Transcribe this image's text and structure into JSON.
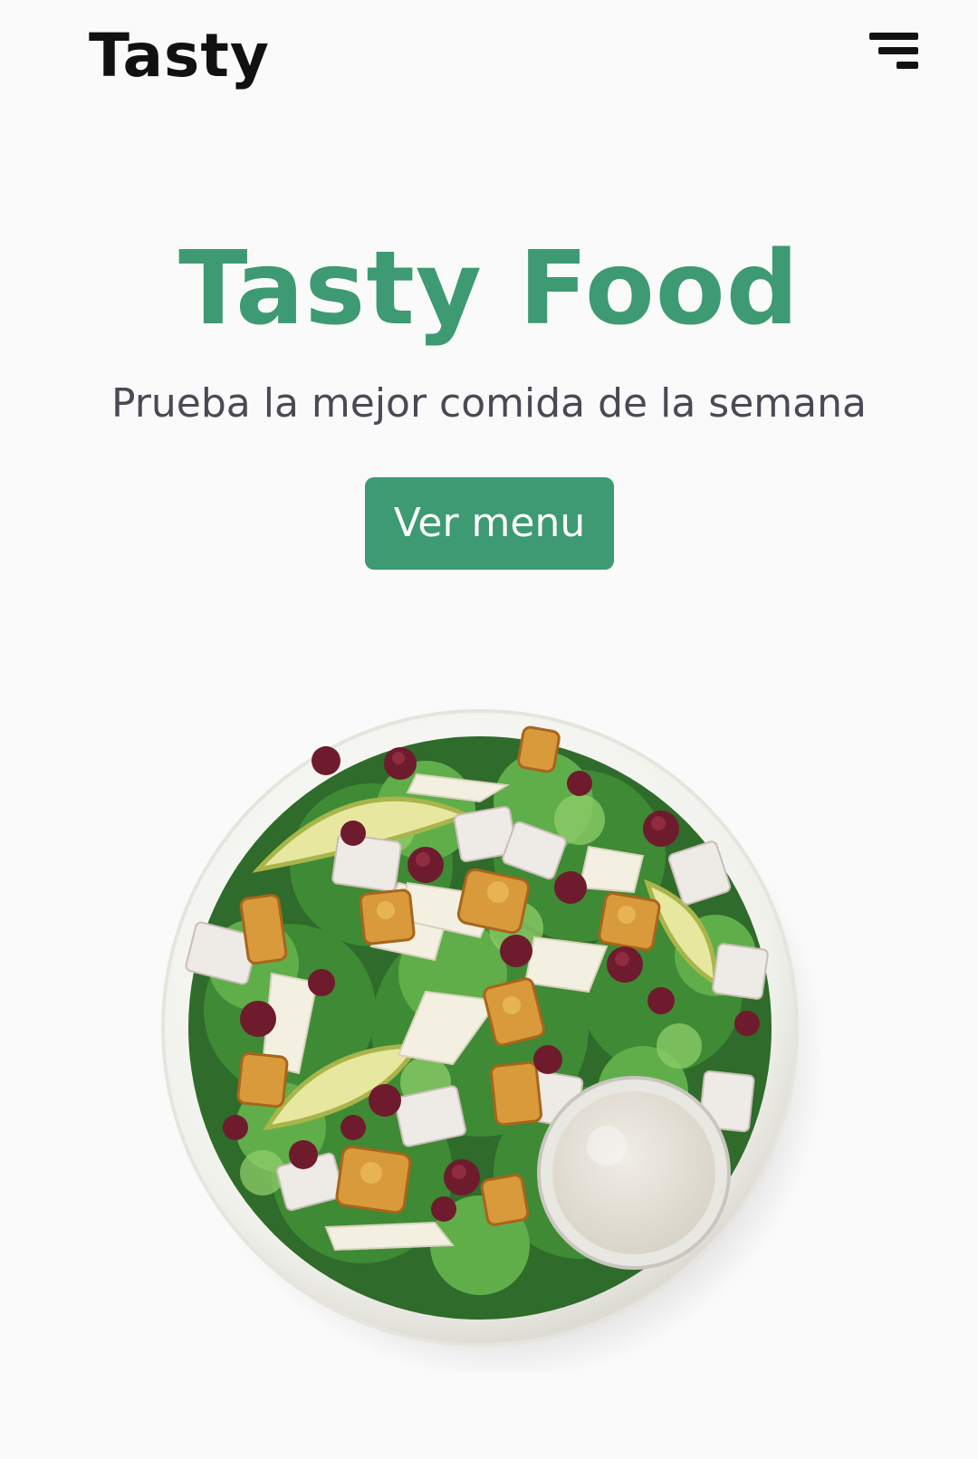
{
  "header": {
    "logo": "Tasty",
    "menu_icon": "hamburger-menu-icon"
  },
  "hero": {
    "title": "Tasty Food",
    "subtitle": "Prueba la mejor comida de la semana",
    "cta_label": "Ver menu"
  },
  "colors": {
    "brand_green": "#3d9a72",
    "text_dark": "#111111",
    "text_muted": "#4a4a55",
    "background": "#fafafa"
  },
  "image": {
    "subject": "salad-bowl"
  }
}
